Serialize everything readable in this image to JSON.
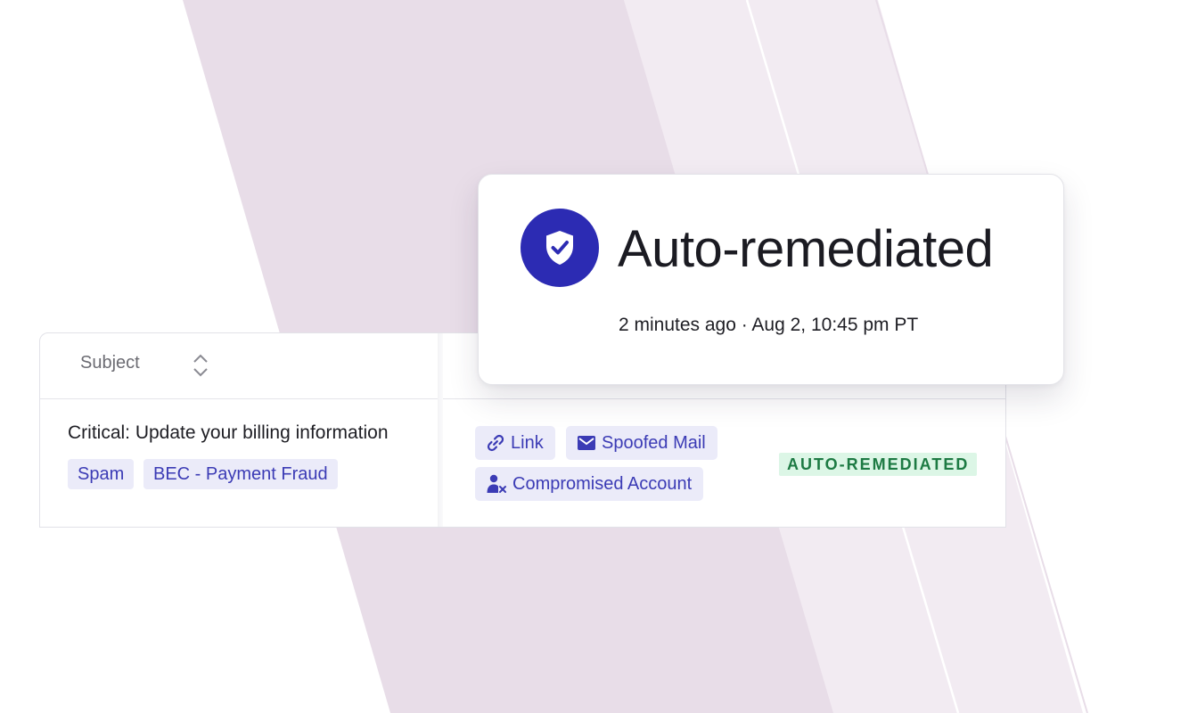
{
  "table": {
    "subject_header": "Subject",
    "row": {
      "subject": "Critical: Update your billing information",
      "tags": [
        "Spam",
        "BEC - Payment Fraud"
      ],
      "chips": {
        "link": "Link",
        "spoofed_mail": "Spoofed Mail",
        "compromised_account": "Compromised Account"
      },
      "status": "AUTO-REMEDIATED"
    }
  },
  "popup": {
    "title": "Auto-remediated",
    "time": "2 minutes ago · Aug 2, 10:45 pm PT",
    "icon": "shield-check-icon"
  },
  "colors": {
    "accent": "#2c2bb3",
    "tag_bg": "#ebebf9",
    "tag_text": "#3b3bb5",
    "status_bg": "#dcf6e6",
    "status_text": "#1d7a43",
    "stripe": "#e8dde8"
  }
}
